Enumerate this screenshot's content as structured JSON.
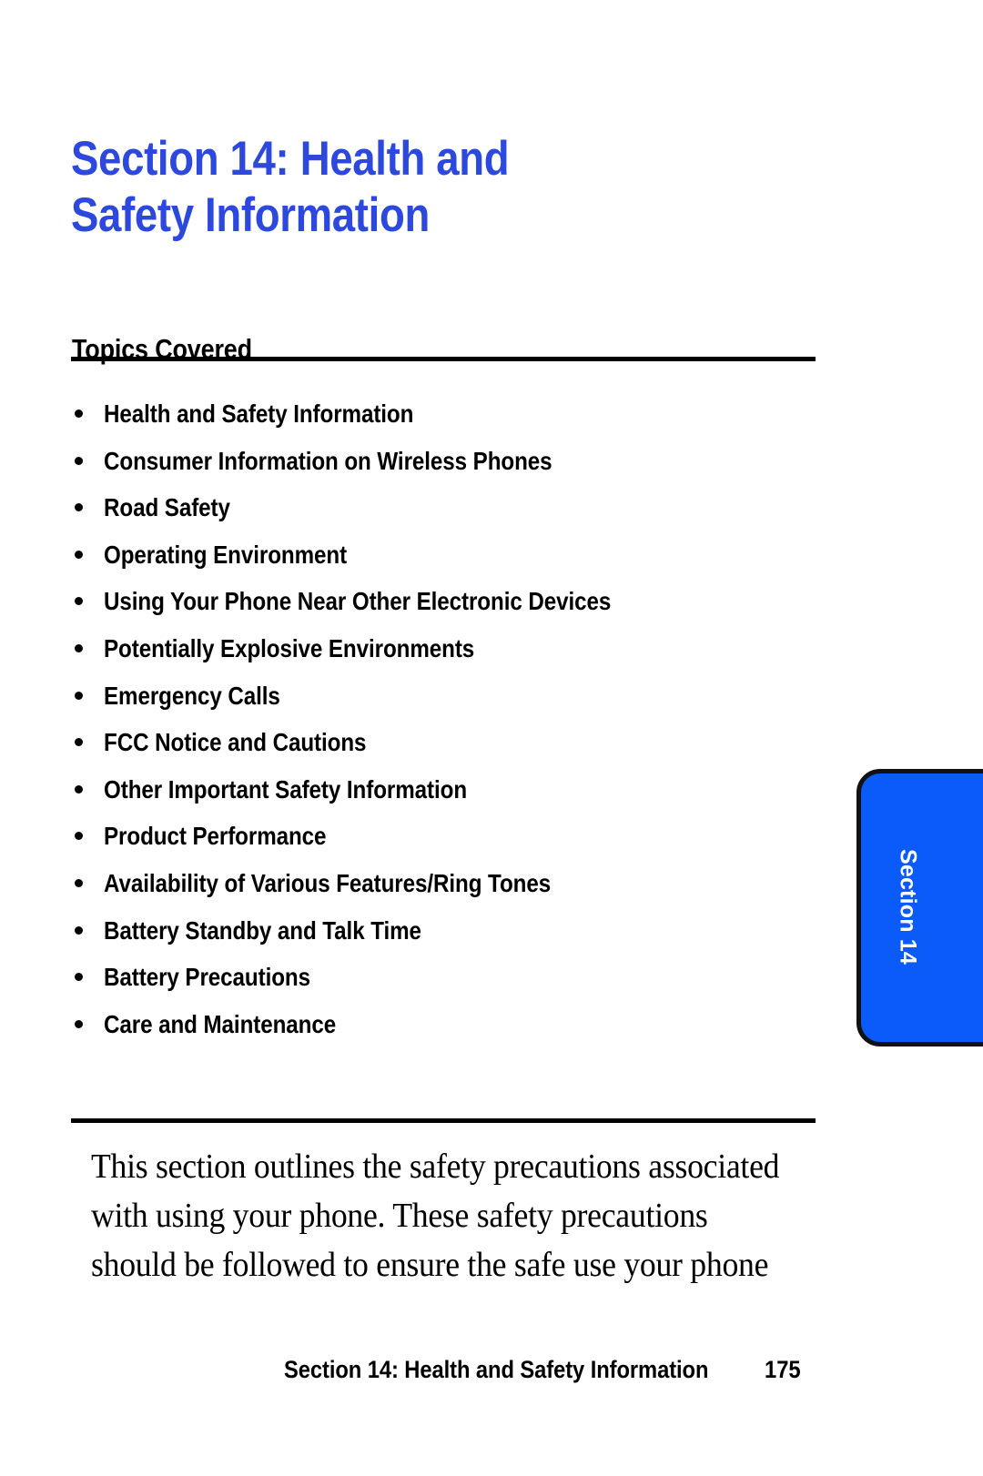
{
  "page": {
    "background_color": "#ffffff",
    "title": "Section 14: Health and Safety Information",
    "title_color": "#2d49dd",
    "page_number": "175"
  },
  "heading": {
    "topics_covered": "Topics Covered"
  },
  "topics": [
    {
      "label": "Health and Safety Information"
    },
    {
      "label": "Consumer Information on Wireless Phones"
    },
    {
      "label": "Road Safety"
    },
    {
      "label": "Operating Environment"
    },
    {
      "label": "Using Your Phone Near Other Electronic Devices"
    },
    {
      "label": "Potentially Explosive Environments"
    },
    {
      "label": "Emergency Calls"
    },
    {
      "label": "FCC Notice and Cautions"
    },
    {
      "label": "Other Important Safety Information"
    },
    {
      "label": "Product Performance"
    },
    {
      "label": "Availability of Various Features/Ring Tones"
    },
    {
      "label": "Battery Standby and Talk Time"
    },
    {
      "label": "Battery Precautions"
    },
    {
      "label": "Care and Maintenance"
    }
  ],
  "side_tab": {
    "label": "Section 14",
    "background_color": "#0a5bfa",
    "text_color": "#ffffff",
    "border_color": "#111111"
  },
  "body": {
    "intro_paragraph": "This section outlines the safety precautions associated with using your phone. These safety precautions should be followed to ensure the safe use your phone"
  },
  "footer": {
    "title": "Section 14: Health and Safety Information",
    "page_number": "175"
  }
}
